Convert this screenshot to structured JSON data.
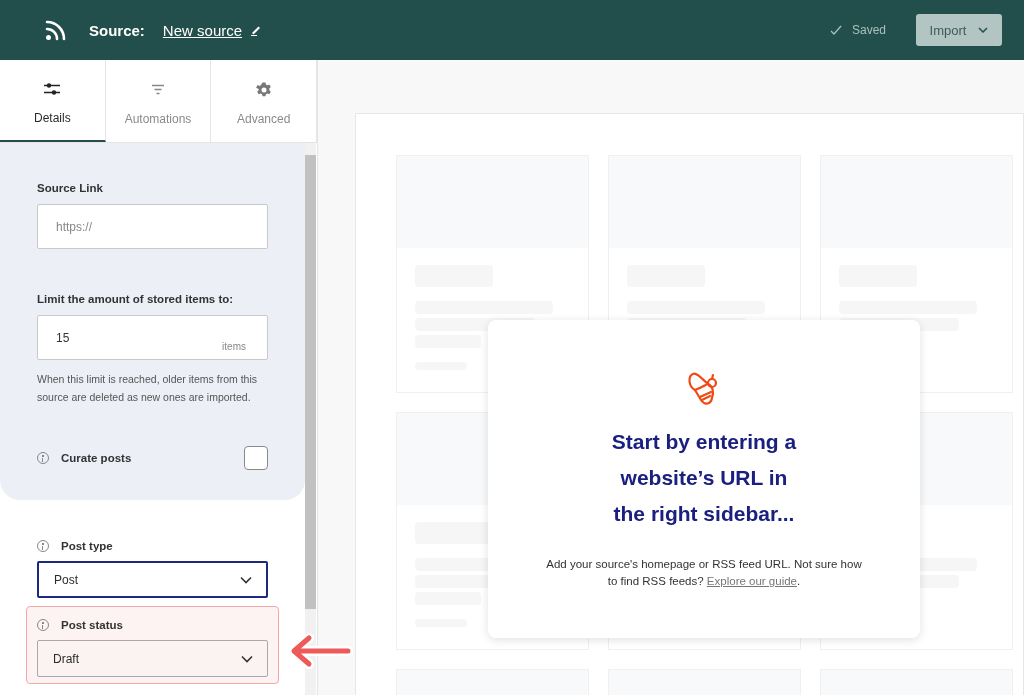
{
  "header": {
    "title_label": "Source:",
    "source_name": "New source",
    "status": "Saved",
    "import_button": "Import"
  },
  "tabs": [
    {
      "label": "Details",
      "kind": "sliders",
      "selected": true
    },
    {
      "label": "Automations",
      "kind": "filter",
      "selected": false
    },
    {
      "label": "Advanced",
      "kind": "gear",
      "selected": false
    }
  ],
  "source_link": {
    "label": "Source Link",
    "placeholder": "https://"
  },
  "limit": {
    "label": "Limit the amount of stored items to:",
    "value": "15",
    "unit": "items",
    "help": "When this limit is reached, older items from this source are deleted as new ones are imported."
  },
  "curate": {
    "label": "Curate posts",
    "checked": false
  },
  "post_type": {
    "label": "Post type",
    "value": "Post",
    "focused": true
  },
  "post_status": {
    "label": "Post status",
    "value": "Draft",
    "highlighted": true
  },
  "empty_state": {
    "heading": "Start by entering a\nwebsite’s URL in\nthe right sidebar...",
    "body": "Add your source's homepage or RSS feed URL. Not sure how to find RSS feeds? ",
    "link": "Explore our guide",
    "body_end": "."
  }
}
